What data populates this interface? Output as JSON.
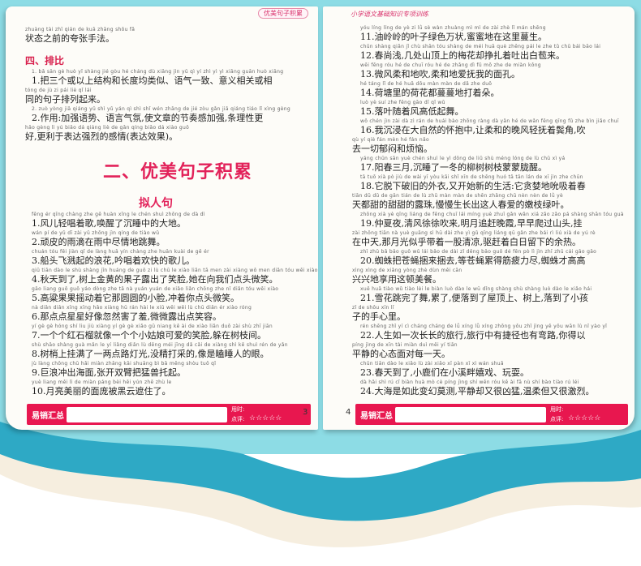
{
  "header_tags": {
    "left": "优美句子积累",
    "right": "小学语文基础知识专项训练"
  },
  "left_page": {
    "top_para": {
      "pinyin": "zhuàng tài zhī qián de kuā zhāng shǒu fǎ",
      "text": "状态之前的夸张手法。"
    },
    "section4_title": "四、排比",
    "s4_item1": [
      {
        "pinyin": "1. bǎ sān gè huò yǐ shàng jié gòu hé cháng dù xiāng jìn yǔ qì yí zhì yì yì xiāng guān huò xiāng",
        "text": "1.把三个或以上结构和长度均类似、语气一致、意义相关或相"
      },
      {
        "pinyin": "tóng de jù zi pái liè qǐ lái",
        "text": "同的句子排列起来。"
      }
    ],
    "s4_item2": [
      {
        "pinyin": "2. zuò yòng jiā qiáng yǔ shì yǔ yán qì shì shǐ wén zhāng de jié zòu gǎn jiā qiáng tiáo lǐ xìng gèng",
        "text": "2.作用:加强语势、语言气氛,使文章的节奏感加强,条理性更"
      },
      {
        "pinyin": "hǎo gèng lì yú biǎo dá qiáng liè de gǎn qíng biǎo dá xiào guǒ",
        "text": "好,更利于表达强烈的感情(表达效果)。"
      }
    ],
    "main_title": "二、优美句子积累",
    "sub_title": "拟人句",
    "sentences": [
      {
        "pinyin": "fēng ér qīng chàng zhe gē huàn xǐng le chén shuì zhōng de dà dì",
        "text": "1.风儿轻唱着歌,唤醒了沉睡中的大地。"
      },
      {
        "pinyin": "wán pí de yǔ dī zài yǔ zhōng jìn qíng de tiào wǔ",
        "text": "2.顽皮的雨滴在雨中尽情地跳舞。"
      },
      {
        "pinyin": "chuán tóu fēi jiàn qǐ de làng huā yín chàng zhe huān kuài de gē ér",
        "text": "3.船头飞溅起的浪花,吟唱着欢快的歌儿。"
      },
      {
        "pinyin": "qiū tiān dào le shù shàng jīn huáng de guǒ zi lù chū le xiào liǎn tā men zài xiàng wǒ men diǎn tóu wēi xiào",
        "text": "4.秋天到了,树上金黄的果子露出了笑脸,她在向我们点头微笑。"
      },
      {
        "pinyin": "gāo liang guǒ guǒ yáo dòng zhe tā nà yuán yuán de xiǎo liǎn chōng zhe nǐ diǎn tóu wēi xiào",
        "text": "5.高粱果果摇动着它那圆圆的小脸,冲着你点头微笑。"
      },
      {
        "pinyin": "nà diǎn diǎn xīng xīng hǎo xiàng hū rán hài le xiū wēi wēi lù chū diǎn ér xiào róng",
        "text": "6.那点点星星好像忽然害了羞,微微露出点笑容。"
      },
      {
        "pinyin": "yí gè gè hóng shí liu jiù xiàng yí gè gè xiǎo gū niang kě ài de xiào liǎn duǒ zài shù zhī jiān",
        "text": "7.一个个红石榴就像一个个小姑娘可爱的笑脸,躲在树枝间。"
      },
      {
        "pinyin": "shù shāo shàng guà mǎn le yí liǎng diǎn lù dēng méi jīng dǎ cǎi de xiàng shì kē shuì rén de yǎn",
        "text": "8.树梢上挂满了一两点路灯光,没精打采的,像是瞌睡人的眼。"
      },
      {
        "pinyin": "jù làng chōng chū hǎi miàn zhāng kāi shuāng bì bǎ měng shòu tuō qǐ",
        "text": "9.巨浪冲出海面,张开双臂把猛兽托起。"
      },
      {
        "pinyin": "yuè liang měi lì de miàn páng bèi hēi yún zhē zhù le",
        "text": "10.月亮美丽的面庞被黑云遮住了。"
      }
    ],
    "page_number": "3",
    "footer": {
      "label": "易销汇总",
      "time_label": "用时:",
      "rating_label": "点评:",
      "stars": "☆☆☆☆☆"
    }
  },
  "right_page": {
    "sentences": [
      {
        "pinyin": "yóu líng líng de yè zi lǜ sè wàn zhuàng mì mì de zài zhè lǐ mán shēng",
        "text": "11.油岭岭的叶子绿色万状,蜜蜜地在这里蔓生。"
      },
      {
        "pinyin": "chūn shàng qiǎn jǐ chù shān tóu shàng de méi huā què zhēng pái le zhe tǔ chū bái bāo lái",
        "text": "12.春尚浅,几处山顶上的梅花却挣扎着吐出白苞来。"
      },
      {
        "pinyin": "wēi fēng róu hé de chuī róu hé de zhǎng dì fǔ mō zhe de miàn kǒng",
        "text": "13.微风柔和地吹,柔和地爱抚我的面孔。"
      },
      {
        "pinyin": "hé táng lǐ de hé huā dōu màn màn de dǎ zhe duǒ",
        "text": "14.荷塘里的荷花都蔓蔓地打着朵。"
      },
      {
        "pinyin": "luò yè suí zhe fēng gāo dī qǐ wǔ",
        "text": "15.落叶随着风高低起舞。"
      },
      {
        "pinyin": "wǒ chén jìn zài dà zì rán de huái bào zhōng ràng dà yǎn hé de wǎn fēng qīng fǔ zhe bìn jiǎo chuī",
        "text": "16.我沉浸在大自然的怀抱中,让柔和的晚风轻抚着鬓角,吹"
      },
      {
        "pinyin": "qù yí qiè fán mèn hé fán nǎo",
        "text": "去一切郁闷和烦恼。"
      },
      {
        "pinyin": "yáng chūn sān yuè chén shuì le yì dōng de liǔ shù méng lóng de lù chū xì yá",
        "text": "17.阳春三月,沉睡了一冬的柳树树枝蒙蒙胧醒。"
      },
      {
        "pinyin": "tā tuō xià pò jiù de wài yī yòu kāi shǐ xīn de shēng huó tā tān lán de xī jìn zhe chūn",
        "text": "18.它脱下破旧的外衣,又开始新的生活:它贪婪地吮吸着春"
      },
      {
        "pinyin": "tiān dū dū de gān tián de lù zhū màn màn de shēn zhǎng chū nèn nèn de lǜ yè",
        "text": "天都甜的甜甜的露珠,慢慢生长出这人春爱的嫩枝绿叶。"
      },
      {
        "pinyin": "zhōng xià yè qīng liáng de fēng chuī lái míng yuè zhuī gǎn wǎn xiá zǎo zǎo pá shàng shān tóu guà",
        "text": "19.仲夏夜,清风徐徐吹来,明月追赶晚霞,早早爬过山头,挂"
      },
      {
        "pinyin": "zài zhōng tiān nà yuè guāng sì hū dài zhe yì gǔ qīng liáng qū gǎn zhe bái rì liú xià de yú rè",
        "text": "在中天,那月光似乎带着一股清凉,驱赶着白日留下的余热。"
      },
      {
        "pinyin": "zhī zhū bǎ bāo guǒ wǔ lái bǎo de dài zǐ děng bāo guǒ dé fēn pò lì jìn zhī zhū cái gāo gāo",
        "text": "20.蜘蛛把苍蝇捆来捆去,等苍蝇累得筋疲力尽,蜘蛛才高高"
      },
      {
        "pinyin": "xìng xìng de xiǎng yòng zhè dùn měi cān",
        "text": "兴兴地享用这顿美餐。"
      },
      {
        "pinyin": "xuě huā tiào wǔ tiào lèi le biàn luò dào le wū dǐng shàng shù shàng luò dào le xiǎo hái",
        "text": "21.雪花跳完了舞,累了,便落到了屋顶上、树上,落到了小孩"
      },
      {
        "pinyin": "zǐ de shǒu xīn lǐ",
        "text": "子的手心里。"
      },
      {
        "pinyin": "rén shēng zhǐ yí cì cháng cháng de lǚ xíng lǚ xíng zhōng yǒu zhǐ jìng yě yǒu wān lù nǐ yào yǐ",
        "text": "22.人生如一次长长的旅行,旅行中有捷径也有弯路,你得以"
      },
      {
        "pinyin": "píng jìng de xīn tài miàn duì měi yí tiān",
        "text": "平静的心态面对每一天。"
      },
      {
        "pinyin": "chūn tiān dào le xiǎo lù zài xiǎo xī pàn xī xì wán shuǎ",
        "text": "23.春天到了,小鹿们在小溪畔嬉戏、玩耍。"
      },
      {
        "pinyin": "dà hǎi shì rú cǐ biàn huà mò cè píng jìng shí wēn róu kě ài fā nù shí bào tiào rú léi",
        "text": "24.大海是如此变幻莫测,平静却又很凶猛,温柔但又很激烈。"
      }
    ],
    "page_number": "4",
    "footer": {
      "label": "易销汇总",
      "time_label": "用时:",
      "rating_label": "点评:",
      "stars": "☆☆☆☆☆"
    }
  }
}
